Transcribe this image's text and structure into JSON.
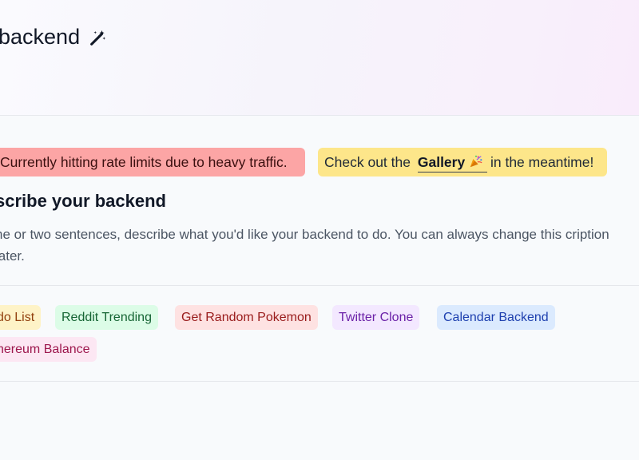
{
  "hero": {
    "title": "backend"
  },
  "banners": {
    "error_text": "Currently hitting rate limits due to heavy traffic.",
    "info_prefix": "Check out the",
    "info_link": "Gallery",
    "info_suffix": "in the meantime!"
  },
  "section": {
    "title": "scribe your backend",
    "description": "ne or two sentences, describe what you'd like your backend to do. You can always change this cription later."
  },
  "examples": [
    {
      "label": "do List",
      "color": "#92400e",
      "bg": "#fef3c7"
    },
    {
      "label": "Reddit Trending",
      "color": "#166534",
      "bg": "#dcfce7"
    },
    {
      "label": "Get Random Pokemon",
      "color": "#991b1b",
      "bg": "#fee2e2"
    },
    {
      "label": "Twitter Clone",
      "color": "#6b21a8",
      "bg": "#f3e8ff"
    },
    {
      "label": "Calendar Backend",
      "color": "#1e40af",
      "bg": "#dbeafe"
    },
    {
      "label": "hereum Balance",
      "color": "#9d174d",
      "bg": "#fce7f3"
    }
  ],
  "icons": {
    "title_icon": "magic-wand-icon",
    "gallery_icon": "party-popper-icon"
  }
}
